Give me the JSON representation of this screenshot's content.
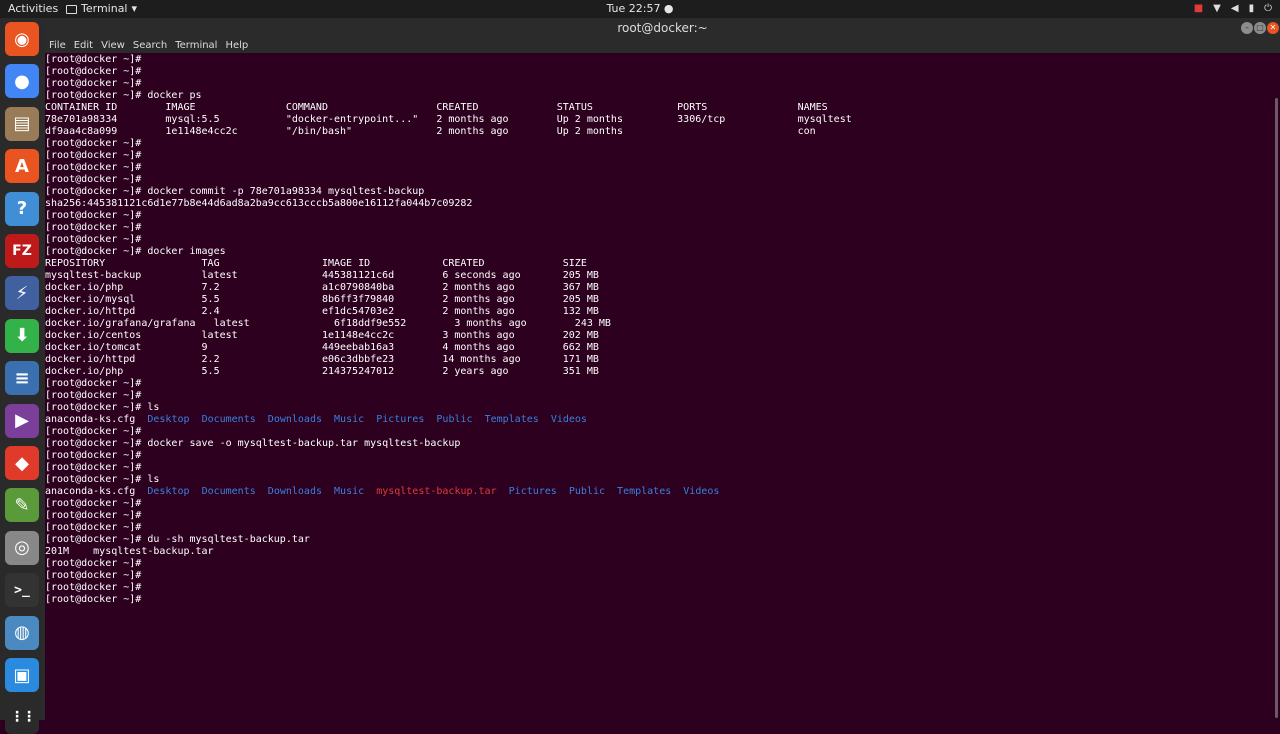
{
  "topbar": {
    "activities": "Activities",
    "app_name": "Terminal",
    "app_arrow": "▾",
    "clock": "Tue 22:57 ●",
    "tray_icons": [
      "camera-icon",
      "wifi-icon",
      "volume-icon",
      "battery-icon",
      "power-icon"
    ]
  },
  "window": {
    "title": "root@docker:~",
    "minimize": "–",
    "maximize": "□",
    "close": "✕"
  },
  "menu": [
    "File",
    "Edit",
    "View",
    "Search",
    "Terminal",
    "Help"
  ],
  "dock": [
    {
      "name": "ubuntu-software-icon",
      "glyph": "◉",
      "color": "#e95420"
    },
    {
      "name": "chrome-icon",
      "glyph": "●",
      "color": "#4285f4"
    },
    {
      "name": "files-icon",
      "glyph": "▤",
      "color": "#9a7b58"
    },
    {
      "name": "software-center-icon",
      "glyph": "A",
      "color": "#e95420"
    },
    {
      "name": "help-icon",
      "glyph": "?",
      "color": "#3f8ed6"
    },
    {
      "name": "filezilla-icon",
      "glyph": "FZ",
      "color": "#bf1a1a"
    },
    {
      "name": "network-icon",
      "glyph": "⚡",
      "color": "#4060a0"
    },
    {
      "name": "download-icon",
      "glyph": "⬇",
      "color": "#34b24a"
    },
    {
      "name": "text-editor-icon",
      "glyph": "≡",
      "color": "#3a6fb0"
    },
    {
      "name": "media-player-icon",
      "glyph": "▶",
      "color": "#7b3f9a"
    },
    {
      "name": "anydesk-icon",
      "glyph": "◆",
      "color": "#e03a2a"
    },
    {
      "name": "gedit-icon",
      "glyph": "✎",
      "color": "#5a9a3a"
    },
    {
      "name": "camera-app-icon",
      "glyph": "◎",
      "color": "#888888"
    },
    {
      "name": "terminal-icon",
      "glyph": ">_",
      "color": "#333333"
    },
    {
      "name": "browser-icon",
      "glyph": "◍",
      "color": "#4a8ac0"
    },
    {
      "name": "virtualbox-icon",
      "glyph": "▣",
      "color": "#2a8ae0"
    },
    {
      "name": "apps-grid-icon",
      "glyph": "⋮⋮",
      "color": "#2a2a2a"
    }
  ],
  "terminal": {
    "lines": [
      [
        {
          "t": "[root@docker ~]#"
        }
      ],
      [
        {
          "t": "[root@docker ~]#"
        }
      ],
      [
        {
          "t": "[root@docker ~]#"
        }
      ],
      [
        {
          "t": "[root@docker ~]# docker ps"
        }
      ],
      [
        {
          "t": "CONTAINER ID        IMAGE               COMMAND                  CREATED             STATUS              PORTS               NAMES"
        }
      ],
      [
        {
          "t": "78e701a98334        mysql:5.5           \"docker-entrypoint...\"   2 months ago        Up 2 months         3306/tcp            mysqltest"
        }
      ],
      [
        {
          "t": "df9aa4c8a099        1e1148e4cc2c        \"/bin/bash\"              2 months ago        Up 2 months                             con"
        }
      ],
      [
        {
          "t": "[root@docker ~]#"
        }
      ],
      [
        {
          "t": "[root@docker ~]#"
        }
      ],
      [
        {
          "t": "[root@docker ~]#"
        }
      ],
      [
        {
          "t": "[root@docker ~]#"
        }
      ],
      [
        {
          "t": "[root@docker ~]# docker commit -p 78e701a98334 mysqltest-backup"
        }
      ],
      [
        {
          "t": "sha256:445381121c6d1e77b8e44d6ad8a2ba9cc613cccb5a800e16112fa044b7c09282"
        }
      ],
      [
        {
          "t": "[root@docker ~]#"
        }
      ],
      [
        {
          "t": "[root@docker ~]#"
        }
      ],
      [
        {
          "t": "[root@docker ~]#"
        }
      ],
      [
        {
          "t": "[root@docker ~]# docker images"
        }
      ],
      [
        {
          "t": "REPOSITORY                TAG                 IMAGE ID            CREATED             SIZE"
        }
      ],
      [
        {
          "t": "mysqltest-backup          latest              445381121c6d        6 seconds ago       205 MB"
        }
      ],
      [
        {
          "t": "docker.io/php             7.2                 a1c0790840ba        2 months ago        367 MB"
        }
      ],
      [
        {
          "t": "docker.io/mysql           5.5                 8b6ff3f79840        2 months ago        205 MB"
        }
      ],
      [
        {
          "t": "docker.io/httpd           2.4                 ef1dc54703e2        2 months ago        132 MB"
        }
      ],
      [
        {
          "t": "docker.io/grafana/grafana   latest              6f18ddf9e552        3 months ago        243 MB"
        }
      ],
      [
        {
          "t": "docker.io/centos          latest              1e1148e4cc2c        3 months ago        202 MB"
        }
      ],
      [
        {
          "t": "docker.io/tomcat          9                   449eebab16a3        4 months ago        662 MB"
        }
      ],
      [
        {
          "t": "docker.io/httpd           2.2                 e06c3dbbfe23        14 months ago       171 MB"
        }
      ],
      [
        {
          "t": "docker.io/php             5.5                 214375247012        2 years ago         351 MB"
        }
      ],
      [
        {
          "t": "[root@docker ~]#"
        }
      ],
      [
        {
          "t": "[root@docker ~]#"
        }
      ],
      [
        {
          "t": "[root@docker ~]# ls"
        }
      ],
      [
        {
          "t": "anaconda-ks.cfg  "
        },
        {
          "t": "Desktop",
          "c": "dir"
        },
        {
          "t": "  "
        },
        {
          "t": "Documents",
          "c": "dir"
        },
        {
          "t": "  "
        },
        {
          "t": "Downloads",
          "c": "dir"
        },
        {
          "t": "  "
        },
        {
          "t": "Music",
          "c": "dir"
        },
        {
          "t": "  "
        },
        {
          "t": "Pictures",
          "c": "dir"
        },
        {
          "t": "  "
        },
        {
          "t": "Public",
          "c": "dir"
        },
        {
          "t": "  "
        },
        {
          "t": "Templates",
          "c": "dir"
        },
        {
          "t": "  "
        },
        {
          "t": "Videos",
          "c": "dir"
        }
      ],
      [
        {
          "t": "[root@docker ~]#"
        }
      ],
      [
        {
          "t": "[root@docker ~]# docker save -o mysqltest-backup.tar mysqltest-backup"
        }
      ],
      [
        {
          "t": "[root@docker ~]#"
        }
      ],
      [
        {
          "t": "[root@docker ~]#"
        }
      ],
      [
        {
          "t": "[root@docker ~]# ls"
        }
      ],
      [
        {
          "t": "anaconda-ks.cfg  "
        },
        {
          "t": "Desktop",
          "c": "dir"
        },
        {
          "t": "  "
        },
        {
          "t": "Documents",
          "c": "dir"
        },
        {
          "t": "  "
        },
        {
          "t": "Downloads",
          "c": "dir"
        },
        {
          "t": "  "
        },
        {
          "t": "Music",
          "c": "dir"
        },
        {
          "t": "  "
        },
        {
          "t": "mysqltest-backup.tar",
          "c": "archive"
        },
        {
          "t": "  "
        },
        {
          "t": "Pictures",
          "c": "dir"
        },
        {
          "t": "  "
        },
        {
          "t": "Public",
          "c": "dir"
        },
        {
          "t": "  "
        },
        {
          "t": "Templates",
          "c": "dir"
        },
        {
          "t": "  "
        },
        {
          "t": "Videos",
          "c": "dir"
        }
      ],
      [
        {
          "t": "[root@docker ~]#"
        }
      ],
      [
        {
          "t": "[root@docker ~]#"
        }
      ],
      [
        {
          "t": "[root@docker ~]#"
        }
      ],
      [
        {
          "t": "[root@docker ~]# du -sh mysqltest-backup.tar"
        }
      ],
      [
        {
          "t": "201M    mysqltest-backup.tar"
        }
      ],
      [
        {
          "t": "[root@docker ~]#"
        }
      ],
      [
        {
          "t": "[root@docker ~]#"
        }
      ],
      [
        {
          "t": "[root@docker ~]#"
        }
      ],
      [
        {
          "t": "[root@docker ~]#"
        }
      ]
    ]
  },
  "colors": {
    "terminal_bg": "#2c001e",
    "directory": "#3c7fe0",
    "archive": "#e03a3a",
    "accent": "#e95420"
  }
}
